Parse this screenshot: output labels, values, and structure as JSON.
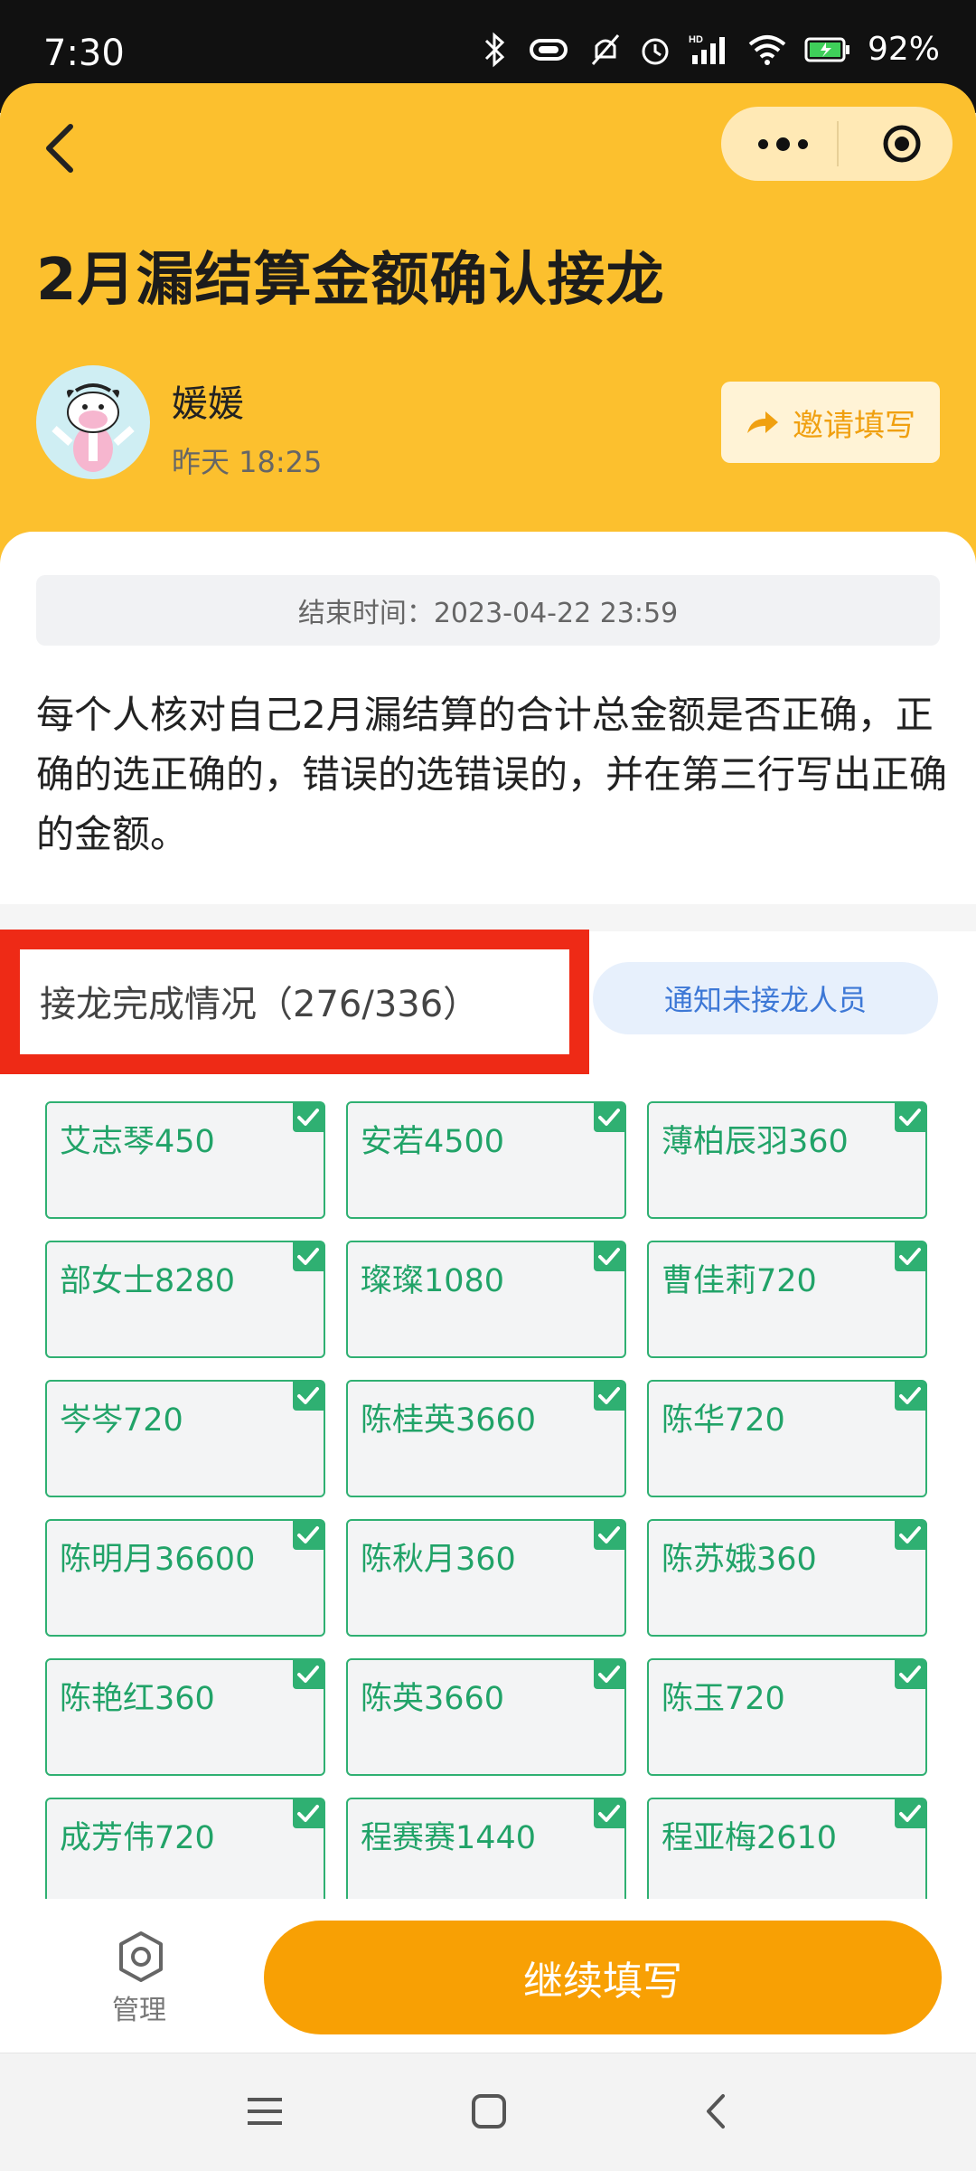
{
  "status_bar": {
    "time": "7:30",
    "battery": "92%",
    "hd_label": "HD"
  },
  "header": {
    "title": "2月漏结算金额确认接龙",
    "author_name": "媛媛",
    "post_time": "昨天 18:25",
    "invite_label": "邀请填写",
    "background_color": "#FCC02E"
  },
  "deadline": "结束时间：2023-04-22 23:59",
  "description": "每个人核对自己2月漏结算的合计总金额是否正确，正确的选正确的，错误的选错误的，并在第三行写出正确的金额。",
  "progress": {
    "label": "接龙完成情况（276/336）",
    "completed": 276,
    "total": 336,
    "notify_label": "通知未接龙人员"
  },
  "entries": [
    {
      "label": "艾志琴450",
      "checked": true
    },
    {
      "label": "安若4500",
      "checked": true
    },
    {
      "label": "薄柏辰羽360",
      "checked": true
    },
    {
      "label": "部女士8280",
      "checked": true
    },
    {
      "label": "璨璨1080",
      "checked": true
    },
    {
      "label": "曹佳莉720",
      "checked": true
    },
    {
      "label": "岑岑720",
      "checked": true
    },
    {
      "label": "陈桂英3660",
      "checked": true
    },
    {
      "label": "陈华720",
      "checked": true
    },
    {
      "label": "陈明月36600",
      "checked": true
    },
    {
      "label": "陈秋月360",
      "checked": true
    },
    {
      "label": "陈苏娥360",
      "checked": true
    },
    {
      "label": "陈艳红360",
      "checked": true
    },
    {
      "label": "陈英3660",
      "checked": true
    },
    {
      "label": "陈玉720",
      "checked": true
    },
    {
      "label": "成芳伟720",
      "checked": true
    },
    {
      "label": "程赛赛1440",
      "checked": true
    },
    {
      "label": "程亚梅2610",
      "checked": true
    }
  ],
  "bottom": {
    "manage_label": "管理",
    "continue_label": "继续填写",
    "accent_color": "#F8A004"
  }
}
